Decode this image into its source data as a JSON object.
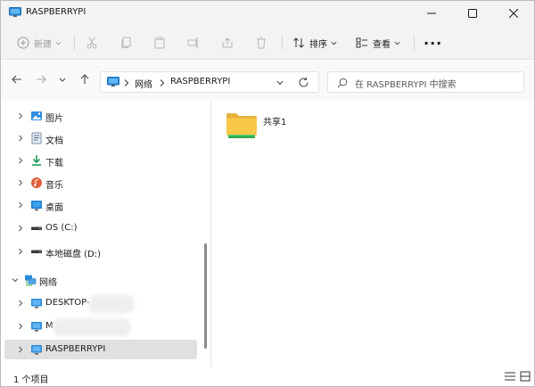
{
  "window": {
    "title": "RASPBERRYPI"
  },
  "toolbar": {
    "new_label": "新建",
    "sort_label": "排序",
    "view_label": "查看",
    "more_label": "..."
  },
  "address": {
    "path": [
      "网络",
      "RASPBERRYPI"
    ]
  },
  "search": {
    "placeholder": "在 RASPBERRYPI 中搜索"
  },
  "sidebar": {
    "items": [
      {
        "label": "图片",
        "icon": "pictures-icon"
      },
      {
        "label": "文档",
        "icon": "documents-icon"
      },
      {
        "label": "下载",
        "icon": "downloads-icon"
      },
      {
        "label": "音乐",
        "icon": "music-icon"
      },
      {
        "label": "桌面",
        "icon": "desktop-icon"
      },
      {
        "label": "OS (C:)",
        "icon": "drive-icon"
      },
      {
        "label": "本地磁盘 (D:)",
        "icon": "drive-icon"
      },
      {
        "label": "网络",
        "icon": "network-icon"
      },
      {
        "label": "DESKTOP-",
        "icon": "computer-icon"
      },
      {
        "label": "M",
        "icon": "computer-icon"
      },
      {
        "label": "RASPBERRYPI",
        "icon": "computer-icon"
      }
    ]
  },
  "content": {
    "items": [
      {
        "label": "共享1",
        "icon": "shared-folder-icon"
      }
    ]
  },
  "status": {
    "item_count": "1 个项目"
  },
  "colors": {
    "accent": "#0067c0",
    "folder": "#f8c948",
    "selected": "#e0e0e0"
  }
}
